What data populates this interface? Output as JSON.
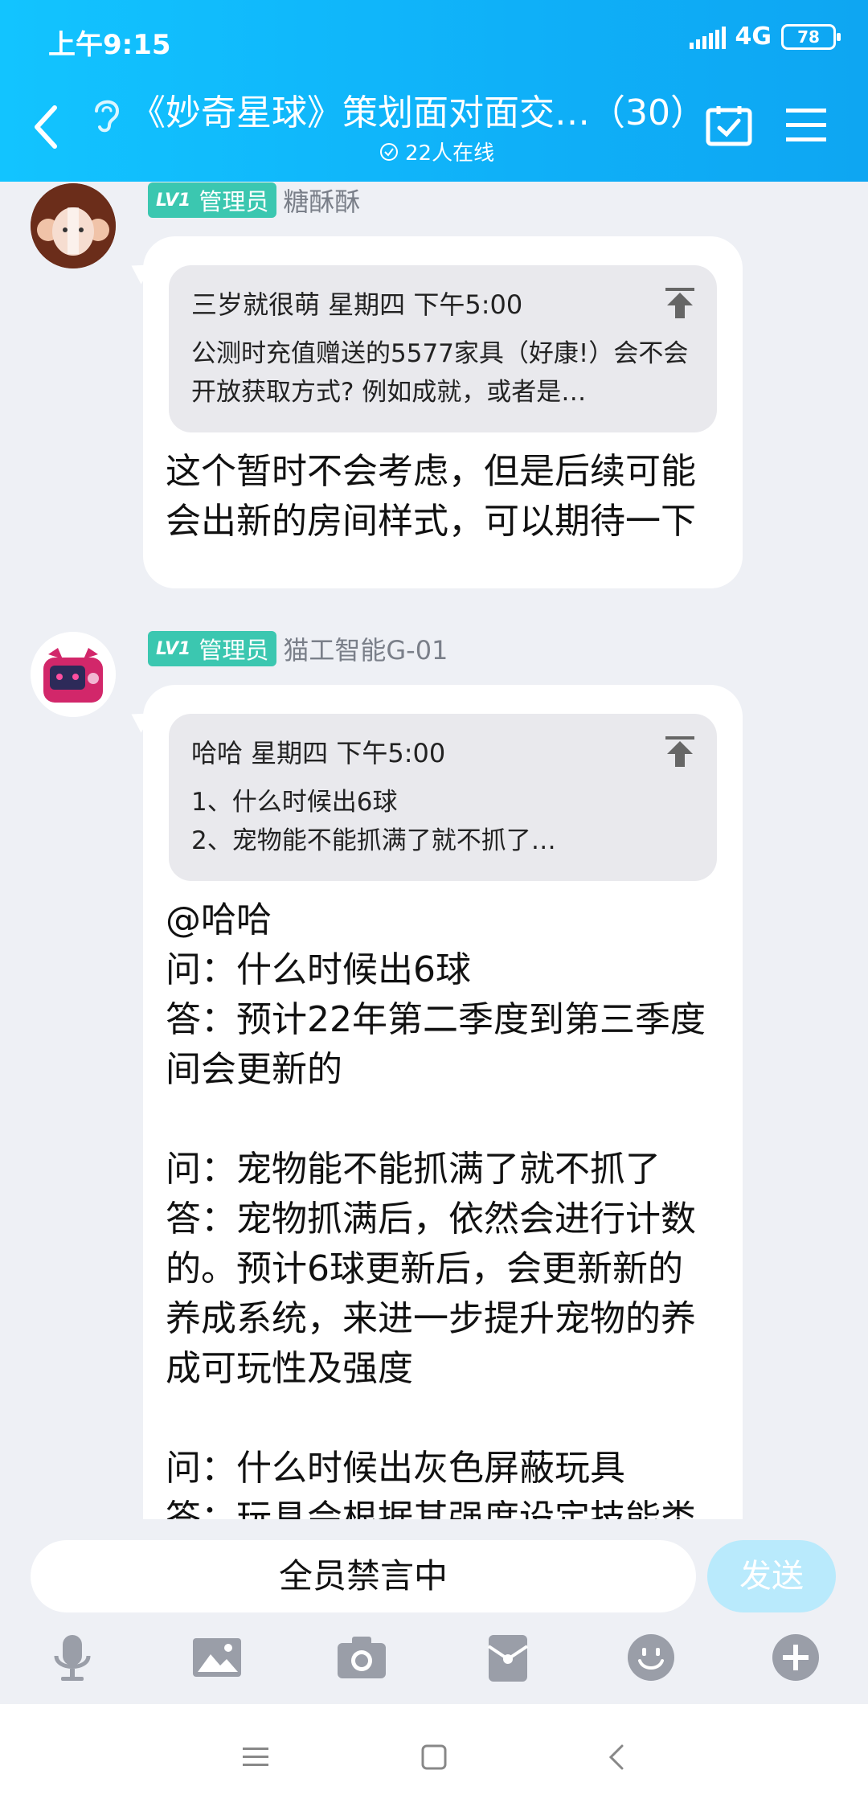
{
  "status": {
    "time": "上午9:15",
    "network": "4G",
    "battery": "78"
  },
  "header": {
    "title": "《妙奇星球》策划面对面交…（30）",
    "online": "22人在线"
  },
  "colors": {
    "header": "#12c4ff",
    "badge": "#3bc7b0",
    "send": "#b9eafc"
  },
  "messages": [
    {
      "badge_level": "LV1",
      "badge_role": "管理员",
      "sender": "糖酥酥",
      "quote_head": "三岁就很萌  星期四 下午5:00",
      "quote_body": "公测时充值赠送的5577家具（好康!）会不会开放获取方式? 例如成就，或者是…",
      "text": "这个暂时不会考虑，但是后续可能会出新的房间样式，可以期待一下"
    },
    {
      "badge_level": "LV1",
      "badge_role": "管理员",
      "sender": "猫工智能G-01",
      "quote_head": "哈哈  星期四 下午5:00",
      "quote_body": "1、什么时候出6球\n2、宠物能不能抓满了就不抓了…",
      "text": "@哈哈\n问：什么时候出6球\n答：预计22年第二季度到第三季度间会更新的\n\n问：宠物能不能抓满了就不抓了\n答：宠物抓满后，依然会进行计数的。预计6球更新后，会更新新的养成系统，来进一步提升宠物的养成可玩性及强度\n\n问：什么时候出灰色屏蔽玩具\n答：玩具会根据其强度设定技能类"
    }
  ],
  "input": {
    "placeholder": "全员禁言中",
    "send": "发送"
  }
}
